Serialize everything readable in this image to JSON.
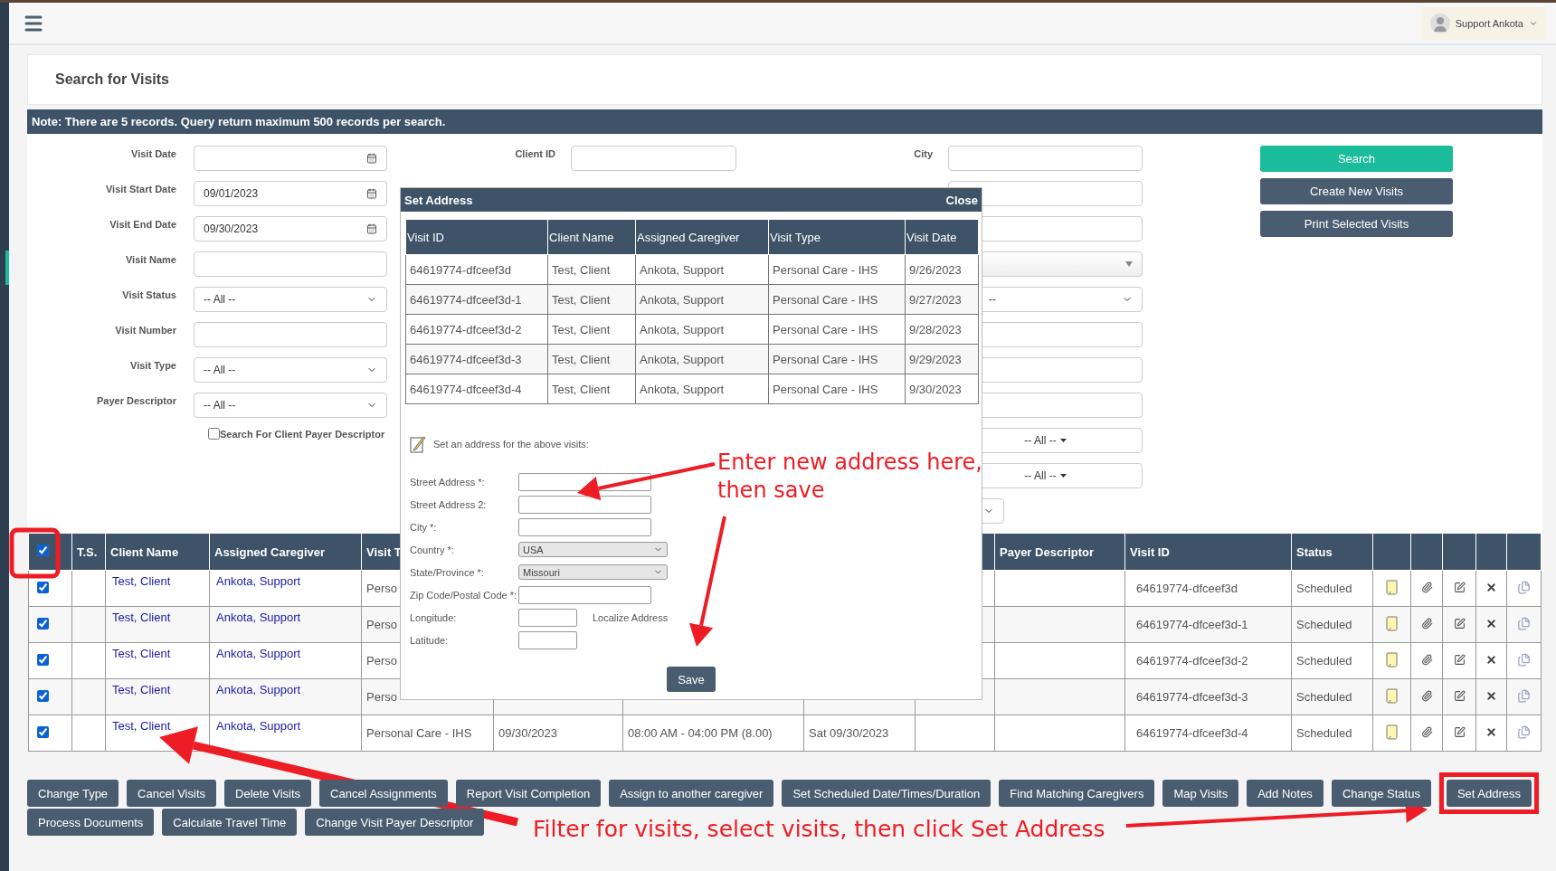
{
  "header": {
    "user_name": "Support Ankota"
  },
  "page_title": "Search for Visits",
  "note": "Note: There are 5 records. Query return maximum 500 records per search.",
  "filters_left": [
    {
      "label": "Visit Date",
      "kind": "date"
    },
    {
      "label": "Visit Start Date",
      "kind": "date",
      "value": "09/01/2023"
    },
    {
      "label": "Visit End Date",
      "kind": "date",
      "value": "09/30/2023"
    },
    {
      "label": "Visit Name",
      "kind": "text"
    },
    {
      "label": "Visit Status",
      "kind": "select",
      "value": "-- All --"
    },
    {
      "label": "Visit Number",
      "kind": "text"
    },
    {
      "label": "Visit Type",
      "kind": "select",
      "value": "-- All --"
    },
    {
      "label": "Payer Descriptor",
      "kind": "select",
      "value": "-- All --"
    }
  ],
  "client_payer_checkbox": {
    "label": "Search For Client Payer Descriptor",
    "checked": false
  },
  "filters_middle": [
    {
      "label": "Client ID",
      "kind": "text"
    }
  ],
  "filters_right": [
    {
      "label": "City",
      "kind": "text"
    },
    {
      "kind": "text"
    },
    {
      "kind": "text"
    },
    {
      "kind": "combo"
    },
    {
      "kind": "select",
      "value": "--"
    },
    {
      "kind": "text"
    },
    {
      "kind": "text"
    },
    {
      "kind": "text"
    },
    {
      "kind": "menu",
      "value": "-- All --"
    },
    {
      "kind": "menu",
      "value": "-- All --"
    },
    {
      "kind": "small-select"
    }
  ],
  "actions": [
    {
      "label": "Search",
      "kind": "primary"
    },
    {
      "label": "Create New Visits",
      "kind": "secondary"
    },
    {
      "label": "Print Selected Visits",
      "kind": "secondary"
    }
  ],
  "table": {
    "select_all_checked": true,
    "columns_left": [
      "T.S.",
      "Client Name",
      "Assigned Caregiver",
      "Visit T"
    ],
    "columns_right": [
      "Payer Descriptor",
      "Visit ID",
      "Status"
    ],
    "rows": [
      {
        "checked": true,
        "client_name": "Test, Client",
        "caregiver": "Ankota, Support",
        "visit_type": "Perso",
        "visit_id": "64619774-dfceef3d",
        "status": "Scheduled"
      },
      {
        "checked": true,
        "client_name": "Test, Client",
        "caregiver": "Ankota, Support",
        "visit_type": "Perso",
        "visit_id": "64619774-dfceef3d-1",
        "status": "Scheduled"
      },
      {
        "checked": true,
        "client_name": "Test, Client",
        "caregiver": "Ankota, Support",
        "visit_type": "Perso",
        "visit_id": "64619774-dfceef3d-2",
        "status": "Scheduled"
      },
      {
        "checked": true,
        "client_name": "Test, Client",
        "caregiver": "Ankota, Support",
        "visit_type": "Perso",
        "visit_id": "64619774-dfceef3d-3",
        "status": "Scheduled"
      },
      {
        "checked": true,
        "client_name": "Test, Client",
        "caregiver": "Ankota, Support",
        "visit_type": "Personal Care - IHS",
        "visit_date": "09/30/2023",
        "time": "08:00 AM - 04:00 PM (8.00)",
        "day": "Sat 09/30/2023",
        "visit_id": "64619774-dfceef3d-4",
        "status": "Scheduled"
      }
    ]
  },
  "bulk_actions": [
    [
      {
        "label": "Change Type",
        "highlighted": false
      },
      {
        "label": "Cancel Visits",
        "highlighted": false
      },
      {
        "label": "Delete Visits",
        "highlighted": false
      },
      {
        "label": "Cancel Assignments",
        "highlighted": false
      },
      {
        "label": "Report Visit Completion",
        "highlighted": false
      },
      {
        "label": "Assign to another caregiver",
        "highlighted": false
      },
      {
        "label": "Set Scheduled Date/Times/Duration",
        "highlighted": false
      },
      {
        "label": "Find Matching Caregivers",
        "highlighted": false
      },
      {
        "label": "Map Visits",
        "highlighted": false
      },
      {
        "label": "Add Notes",
        "highlighted": false
      },
      {
        "label": "Change Status",
        "highlighted": false
      },
      {
        "label": "Set Address",
        "highlighted": true
      }
    ],
    [
      {
        "label": "Process Documents",
        "highlighted": false
      },
      {
        "label": "Calculate Travel Time",
        "highlighted": false
      },
      {
        "label": "Change Visit Payer Descriptor",
        "highlighted": false
      }
    ]
  ],
  "dialog": {
    "title": "Set Address",
    "close": "Close",
    "columns": [
      "Visit ID",
      "Client Name",
      "Assigned Caregiver",
      "Visit Type",
      "Visit Date"
    ],
    "rows": [
      [
        "64619774-dfceef3d",
        "Test, Client",
        "Ankota, Support",
        "Personal Care - IHS",
        "9/26/2023"
      ],
      [
        "64619774-dfceef3d-1",
        "Test, Client",
        "Ankota, Support",
        "Personal Care - IHS",
        "9/27/2023"
      ],
      [
        "64619774-dfceef3d-2",
        "Test, Client",
        "Ankota, Support",
        "Personal Care - IHS",
        "9/28/2023"
      ],
      [
        "64619774-dfceef3d-3",
        "Test, Client",
        "Ankota, Support",
        "Personal Care - IHS",
        "9/29/2023"
      ],
      [
        "64619774-dfceef3d-4",
        "Test, Client",
        "Ankota, Support",
        "Personal Care - IHS",
        "9/30/2023"
      ]
    ],
    "instruction": "Set an address for the above visits:",
    "fields": [
      {
        "label": "Street Address *:",
        "kind": "text"
      },
      {
        "label": "Street Address 2:",
        "kind": "text"
      },
      {
        "label": "City *:",
        "kind": "text"
      },
      {
        "label": "Country *:",
        "kind": "select",
        "value": "USA"
      },
      {
        "label": "State/Province *:",
        "kind": "select",
        "value": "Missouri"
      },
      {
        "label": "Zip Code/Postal Code *:",
        "kind": "text"
      },
      {
        "label": "Longitude:",
        "kind": "short",
        "link": "Localize Address"
      },
      {
        "label": "Latitude:",
        "kind": "short"
      }
    ],
    "save": "Save"
  },
  "annotations": [
    {
      "lines": [
        "Enter new address here,",
        "then save"
      ]
    },
    {
      "lines": [
        "Filter for visits, select visits, then click Set Address"
      ]
    }
  ]
}
